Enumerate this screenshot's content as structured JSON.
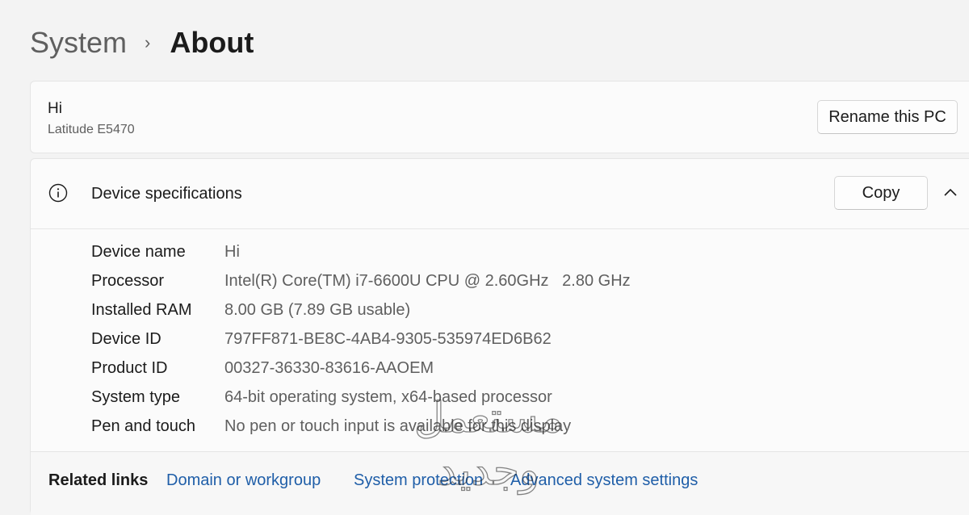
{
  "breadcrumb": {
    "parent": "System",
    "separator": "›",
    "current": "About"
  },
  "pc": {
    "name": "Hi",
    "model": "Latitude E5470",
    "rename_label": "Rename this PC"
  },
  "specs": {
    "title": "Device specifications",
    "copy_label": "Copy",
    "info_icon": "info-icon",
    "collapse_icon": "chevron-up-icon",
    "rows": [
      {
        "label": "Device name",
        "value": "Hi"
      },
      {
        "label": "Processor",
        "value": "Intel(R) Core(TM) i7-6600U CPU @ 2.60GHz   2.80 GHz"
      },
      {
        "label": "Installed RAM",
        "value": "8.00 GB (7.89 GB usable)"
      },
      {
        "label": "Device ID",
        "value": "797FF871-BE8C-4AB4-9305-535974ED6B62"
      },
      {
        "label": "Product ID",
        "value": "00327-36330-83616-AAOEM"
      },
      {
        "label": "System type",
        "value": "64-bit operating system, x64-based processor"
      },
      {
        "label": "Pen and touch",
        "value": "No pen or touch input is available for this display"
      }
    ]
  },
  "related": {
    "title": "Related links",
    "links": [
      "Domain or workgroup",
      "System protection",
      "Advanced system settings"
    ]
  },
  "watermark": {
    "line1": "مستعمل",
    "line2": "وجديد"
  },
  "colors": {
    "background": "#f3f3f3",
    "card": "#fbfbfb",
    "link": "#1f5ea8",
    "secondary_text": "#5f5f5f"
  }
}
